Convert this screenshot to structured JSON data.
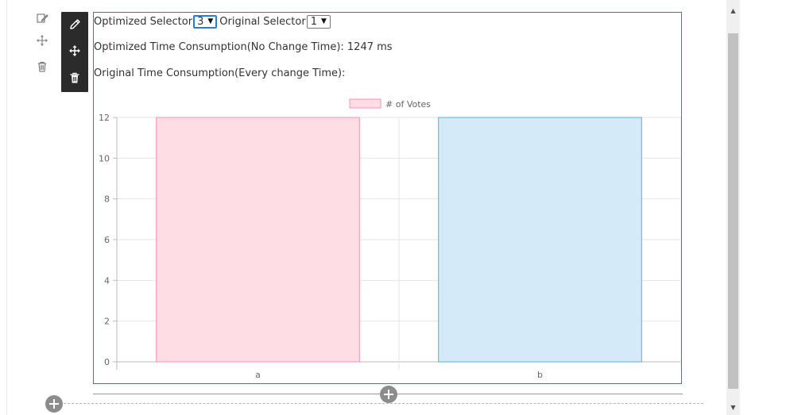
{
  "controls": {
    "optimized_label": "Optimized Selector",
    "optimized_value": "3",
    "original_label": "Original Selector",
    "original_value": "1"
  },
  "info": {
    "optimized_time": "Optimized Time Consumption(No Change Time): 1247 ms",
    "original_time": "Original Time Consumption(Every change Time):"
  },
  "icons": {
    "side": [
      "edit-icon",
      "move-icon",
      "trash-icon"
    ],
    "toolbar": [
      "pencil-icon",
      "move-icon",
      "trash-icon"
    ]
  },
  "colors": {
    "border_accent": "#2e8b7a",
    "toolbar_bg": "#2b2b2b",
    "bar_pink_fill": "#ffdde4",
    "bar_pink_stroke": "#ff8fab",
    "bar_blue_fill": "#d5eaf8",
    "bar_blue_stroke": "#5aaee0"
  },
  "chart_data": {
    "type": "bar",
    "categories": [
      "a",
      "b"
    ],
    "series": [
      {
        "name": "# of Votes",
        "values": [
          12,
          12
        ]
      }
    ],
    "ylim": [
      0,
      12
    ],
    "yticks": [
      0,
      2,
      4,
      6,
      8,
      10,
      12
    ],
    "grid": true,
    "legend": "top-center"
  }
}
